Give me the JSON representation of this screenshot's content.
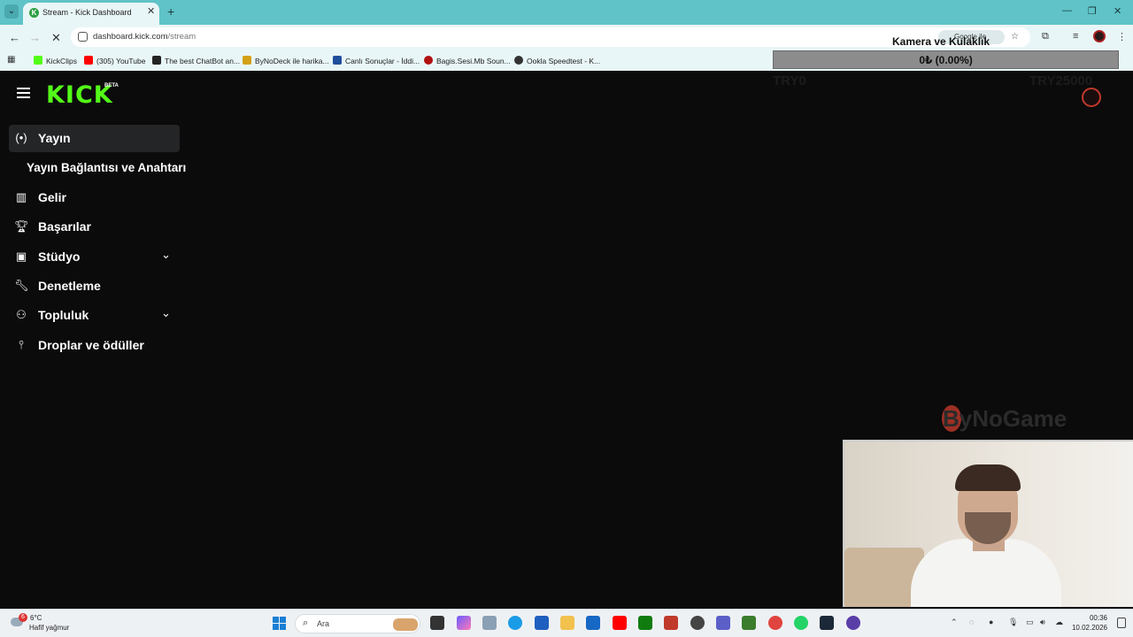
{
  "browser": {
    "tab_title": "Stream - Kick Dashboard",
    "tab_favicon": "K",
    "url_host": "dashboard.kick.com",
    "url_path": "/stream",
    "google_pill": "Google ile",
    "bookmarks": [
      {
        "label": "KickClips",
        "icon": "kick-icon",
        "color": "#53fc18"
      },
      {
        "label": "(305) YouTube",
        "icon": "youtube-icon",
        "color": "#ff0000"
      },
      {
        "label": "The best ChatBot an...",
        "icon": "chatbot-icon",
        "color": "#222222"
      },
      {
        "label": "ByNoDeck ile harika...",
        "icon": "bynodeck-icon",
        "color": "#d4a017"
      },
      {
        "label": "Canlı Sonuçlar - İddi...",
        "icon": "canli-icon",
        "color": "#1f4e9b"
      },
      {
        "label": "Bagis.Sesi.Mb Soun...",
        "icon": "bagis-icon",
        "color": "#b11111"
      },
      {
        "label": "Ookla Speedtest - K...",
        "icon": "ookla-icon",
        "color": "#333333"
      }
    ]
  },
  "overlay": {
    "title": "Kamera ve Kulaklık",
    "donation": "0₺ (0.00%)",
    "goal_left": "TRY0",
    "goal_right": "TRY25000"
  },
  "kick": {
    "logo": "KICK",
    "beta": "BETA",
    "accent": "#53fc18",
    "nav": [
      {
        "label": "Yayın",
        "icon": "broadcast-icon",
        "active": true
      },
      {
        "label": "Yayın Bağlantısı ve Anahtarı",
        "sub": true
      },
      {
        "label": "Gelir",
        "icon": "bar-chart-icon"
      },
      {
        "label": "Başarılar",
        "icon": "trophy-icon"
      },
      {
        "label": "Stüdyo",
        "icon": "studio-icon",
        "expandable": true
      },
      {
        "label": "Denetleme",
        "icon": "wrench-icon"
      },
      {
        "label": "Topluluk",
        "icon": "community-icon",
        "expandable": true
      },
      {
        "label": "Droplar ve ödüller",
        "icon": "drops-icon"
      }
    ]
  },
  "watermark": "ByNoGame",
  "taskbar": {
    "weather_badge": "6",
    "temperature": "6°C",
    "condition": "Hafif yağmur",
    "search_placeholder": "Ara",
    "time": "00:36",
    "date": "10.02.2026"
  }
}
